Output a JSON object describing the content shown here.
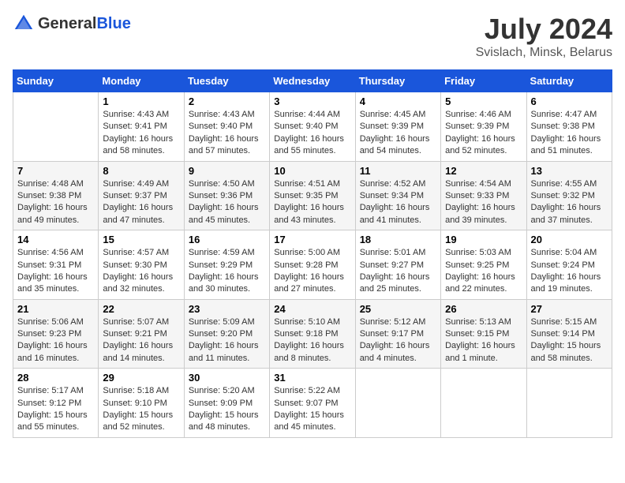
{
  "header": {
    "logo_general": "General",
    "logo_blue": "Blue",
    "title": "July 2024",
    "subtitle": "Svislach, Minsk, Belarus"
  },
  "days_of_week": [
    "Sunday",
    "Monday",
    "Tuesday",
    "Wednesday",
    "Thursday",
    "Friday",
    "Saturday"
  ],
  "weeks": [
    [
      {
        "day": "",
        "sunrise": "",
        "sunset": "",
        "daylight": ""
      },
      {
        "day": "1",
        "sunrise": "Sunrise: 4:43 AM",
        "sunset": "Sunset: 9:41 PM",
        "daylight": "Daylight: 16 hours and 58 minutes."
      },
      {
        "day": "2",
        "sunrise": "Sunrise: 4:43 AM",
        "sunset": "Sunset: 9:40 PM",
        "daylight": "Daylight: 16 hours and 57 minutes."
      },
      {
        "day": "3",
        "sunrise": "Sunrise: 4:44 AM",
        "sunset": "Sunset: 9:40 PM",
        "daylight": "Daylight: 16 hours and 55 minutes."
      },
      {
        "day": "4",
        "sunrise": "Sunrise: 4:45 AM",
        "sunset": "Sunset: 9:39 PM",
        "daylight": "Daylight: 16 hours and 54 minutes."
      },
      {
        "day": "5",
        "sunrise": "Sunrise: 4:46 AM",
        "sunset": "Sunset: 9:39 PM",
        "daylight": "Daylight: 16 hours and 52 minutes."
      },
      {
        "day": "6",
        "sunrise": "Sunrise: 4:47 AM",
        "sunset": "Sunset: 9:38 PM",
        "daylight": "Daylight: 16 hours and 51 minutes."
      }
    ],
    [
      {
        "day": "7",
        "sunrise": "Sunrise: 4:48 AM",
        "sunset": "Sunset: 9:38 PM",
        "daylight": "Daylight: 16 hours and 49 minutes."
      },
      {
        "day": "8",
        "sunrise": "Sunrise: 4:49 AM",
        "sunset": "Sunset: 9:37 PM",
        "daylight": "Daylight: 16 hours and 47 minutes."
      },
      {
        "day": "9",
        "sunrise": "Sunrise: 4:50 AM",
        "sunset": "Sunset: 9:36 PM",
        "daylight": "Daylight: 16 hours and 45 minutes."
      },
      {
        "day": "10",
        "sunrise": "Sunrise: 4:51 AM",
        "sunset": "Sunset: 9:35 PM",
        "daylight": "Daylight: 16 hours and 43 minutes."
      },
      {
        "day": "11",
        "sunrise": "Sunrise: 4:52 AM",
        "sunset": "Sunset: 9:34 PM",
        "daylight": "Daylight: 16 hours and 41 minutes."
      },
      {
        "day": "12",
        "sunrise": "Sunrise: 4:54 AM",
        "sunset": "Sunset: 9:33 PM",
        "daylight": "Daylight: 16 hours and 39 minutes."
      },
      {
        "day": "13",
        "sunrise": "Sunrise: 4:55 AM",
        "sunset": "Sunset: 9:32 PM",
        "daylight": "Daylight: 16 hours and 37 minutes."
      }
    ],
    [
      {
        "day": "14",
        "sunrise": "Sunrise: 4:56 AM",
        "sunset": "Sunset: 9:31 PM",
        "daylight": "Daylight: 16 hours and 35 minutes."
      },
      {
        "day": "15",
        "sunrise": "Sunrise: 4:57 AM",
        "sunset": "Sunset: 9:30 PM",
        "daylight": "Daylight: 16 hours and 32 minutes."
      },
      {
        "day": "16",
        "sunrise": "Sunrise: 4:59 AM",
        "sunset": "Sunset: 9:29 PM",
        "daylight": "Daylight: 16 hours and 30 minutes."
      },
      {
        "day": "17",
        "sunrise": "Sunrise: 5:00 AM",
        "sunset": "Sunset: 9:28 PM",
        "daylight": "Daylight: 16 hours and 27 minutes."
      },
      {
        "day": "18",
        "sunrise": "Sunrise: 5:01 AM",
        "sunset": "Sunset: 9:27 PM",
        "daylight": "Daylight: 16 hours and 25 minutes."
      },
      {
        "day": "19",
        "sunrise": "Sunrise: 5:03 AM",
        "sunset": "Sunset: 9:25 PM",
        "daylight": "Daylight: 16 hours and 22 minutes."
      },
      {
        "day": "20",
        "sunrise": "Sunrise: 5:04 AM",
        "sunset": "Sunset: 9:24 PM",
        "daylight": "Daylight: 16 hours and 19 minutes."
      }
    ],
    [
      {
        "day": "21",
        "sunrise": "Sunrise: 5:06 AM",
        "sunset": "Sunset: 9:23 PM",
        "daylight": "Daylight: 16 hours and 16 minutes."
      },
      {
        "day": "22",
        "sunrise": "Sunrise: 5:07 AM",
        "sunset": "Sunset: 9:21 PM",
        "daylight": "Daylight: 16 hours and 14 minutes."
      },
      {
        "day": "23",
        "sunrise": "Sunrise: 5:09 AM",
        "sunset": "Sunset: 9:20 PM",
        "daylight": "Daylight: 16 hours and 11 minutes."
      },
      {
        "day": "24",
        "sunrise": "Sunrise: 5:10 AM",
        "sunset": "Sunset: 9:18 PM",
        "daylight": "Daylight: 16 hours and 8 minutes."
      },
      {
        "day": "25",
        "sunrise": "Sunrise: 5:12 AM",
        "sunset": "Sunset: 9:17 PM",
        "daylight": "Daylight: 16 hours and 4 minutes."
      },
      {
        "day": "26",
        "sunrise": "Sunrise: 5:13 AM",
        "sunset": "Sunset: 9:15 PM",
        "daylight": "Daylight: 16 hours and 1 minute."
      },
      {
        "day": "27",
        "sunrise": "Sunrise: 5:15 AM",
        "sunset": "Sunset: 9:14 PM",
        "daylight": "Daylight: 15 hours and 58 minutes."
      }
    ],
    [
      {
        "day": "28",
        "sunrise": "Sunrise: 5:17 AM",
        "sunset": "Sunset: 9:12 PM",
        "daylight": "Daylight: 15 hours and 55 minutes."
      },
      {
        "day": "29",
        "sunrise": "Sunrise: 5:18 AM",
        "sunset": "Sunset: 9:10 PM",
        "daylight": "Daylight: 15 hours and 52 minutes."
      },
      {
        "day": "30",
        "sunrise": "Sunrise: 5:20 AM",
        "sunset": "Sunset: 9:09 PM",
        "daylight": "Daylight: 15 hours and 48 minutes."
      },
      {
        "day": "31",
        "sunrise": "Sunrise: 5:22 AM",
        "sunset": "Sunset: 9:07 PM",
        "daylight": "Daylight: 15 hours and 45 minutes."
      },
      {
        "day": "",
        "sunrise": "",
        "sunset": "",
        "daylight": ""
      },
      {
        "day": "",
        "sunrise": "",
        "sunset": "",
        "daylight": ""
      },
      {
        "day": "",
        "sunrise": "",
        "sunset": "",
        "daylight": ""
      }
    ]
  ]
}
